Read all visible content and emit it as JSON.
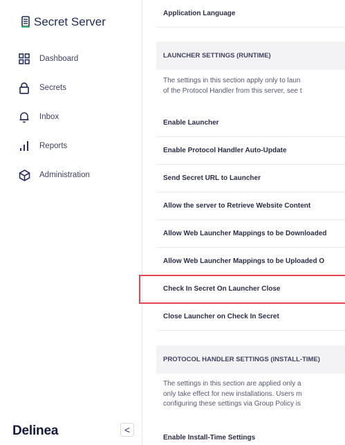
{
  "sidebar": {
    "brand": "Secret Server",
    "items": [
      {
        "label": "Dashboard",
        "icon": "dashboard-icon"
      },
      {
        "label": "Secrets",
        "icon": "lock-icon"
      },
      {
        "label": "Inbox",
        "icon": "bell-icon"
      },
      {
        "label": "Reports",
        "icon": "bar-chart-icon"
      },
      {
        "label": "Administration",
        "icon": "cube-icon"
      }
    ],
    "logo": "Delinea",
    "collapse_glyph": "<"
  },
  "main": {
    "top_row": "Application Language",
    "launcher_section": {
      "title": "LAUNCHER SETTINGS (RUNTIME)",
      "description_lines": [
        "The settings in this section apply only to laun",
        "of the Protocol Handler from this server, see t"
      ],
      "rows": [
        "Enable Launcher",
        "Enable Protocol Handler Auto-Update",
        "Send Secret URL to Launcher",
        "Allow the server to Retrieve Website Content",
        "Allow Web Launcher Mappings to be Downloaded",
        "Allow Web Launcher Mappings to be Uploaded O",
        "Check In Secret On Launcher Close",
        "Close Launcher on Check In Secret"
      ]
    },
    "protocol_section": {
      "title": "PROTOCOL HANDLER SETTINGS (INSTALL-TIME)",
      "description_lines": [
        "The settings in this section are applied only a",
        "only take effect for new installations. Users m",
        "configuring these settings via Group Policy is"
      ],
      "rows": [
        "Enable Install-Time Settings"
      ]
    }
  },
  "colors": {
    "highlight_border": "#e0474f",
    "brand_green": "#3cc07a",
    "brand_navy": "#1f2a5c"
  }
}
